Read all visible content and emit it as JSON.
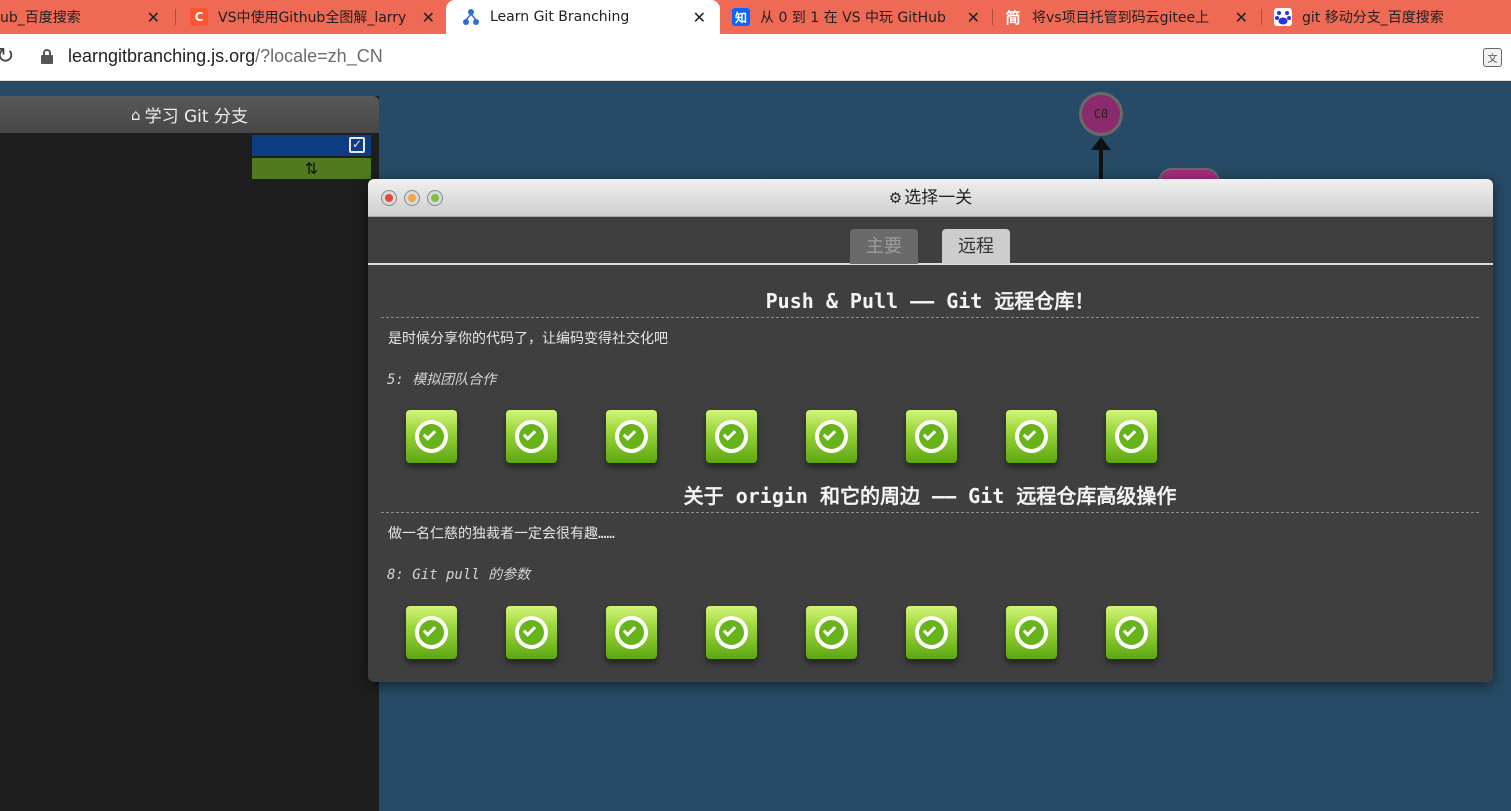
{
  "browser": {
    "tabs": [
      {
        "title": "ub_百度搜索",
        "icon": "baidu-icon",
        "active": false
      },
      {
        "title": "VS中使用Github全图解_larry",
        "icon": "csdn-icon",
        "active": false
      },
      {
        "title": "Learn Git Branching",
        "icon": "learngit-icon",
        "active": true
      },
      {
        "title": "从 0 到 1 在 VS 中玩 GitHub",
        "icon": "zhihu-icon",
        "active": false
      },
      {
        "title": "将vs项目托管到码云gitee上",
        "icon": "jianshu-icon",
        "active": false
      },
      {
        "title": "git 移动分支_百度搜索",
        "icon": "baidu-icon",
        "active": false
      }
    ],
    "favicon_glyphs": {
      "csdn": "C",
      "zhihu": "知",
      "jianshu": "简"
    },
    "close_glyph": "✕",
    "url_host": "learngitbranching.js.org",
    "url_path": "/?locale=zh_CN",
    "reload_glyph": "↻",
    "translate_glyph": "文"
  },
  "left_panel": {
    "title": "学习 Git 分支",
    "home_glyph": "⌂",
    "check_glyph": "✓",
    "sync_glyph": "⇅"
  },
  "graph": {
    "commit_label": "C0"
  },
  "dialog": {
    "title": "选择一关",
    "gear_glyph": "⚙",
    "tabs": {
      "main": "主要",
      "remote": "远程"
    },
    "sections": [
      {
        "title": "Push & Pull —— Git 远程仓库！",
        "description": "是时候分享你的代码了，让编码变得社交化吧",
        "subtitle": "5: 模拟团队合作",
        "levels_completed": 8
      },
      {
        "title": "关于 origin 和它的周边 —— Git 远程仓库高级操作",
        "description": "做一名仁慈的独裁者一定会很有趣……",
        "subtitle": "8: Git pull 的参数",
        "levels_completed": 8
      }
    ]
  },
  "colors": {
    "tab_bar": "#ee6a55",
    "page_background": "#274b66",
    "dialog_background": "#3f3f3f",
    "level_complete": "#7cc22a"
  }
}
